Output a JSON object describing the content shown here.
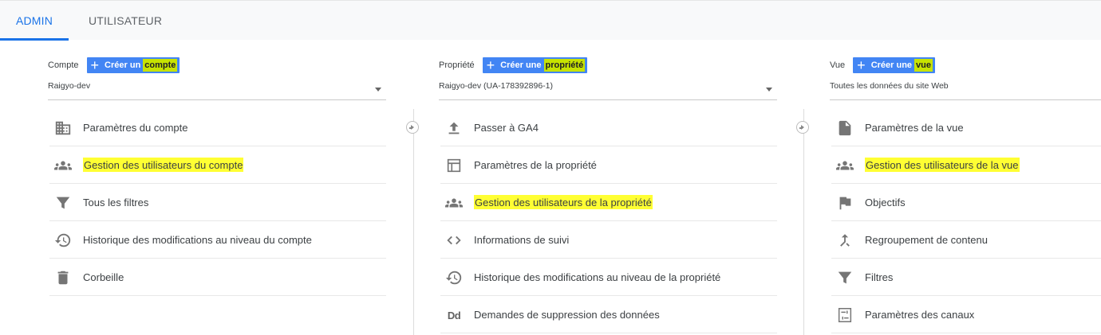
{
  "tabs": {
    "admin": "ADMIN",
    "user": "UTILISATEUR"
  },
  "account": {
    "label": "Compte",
    "create_prefix": "Créer un",
    "create_highlight": "compte",
    "selected": "Raigyo-dev",
    "items": [
      {
        "label": "Paramètres du compte",
        "icon": "building-icon"
      },
      {
        "label": "Gestion des utilisateurs du compte",
        "icon": "people-icon"
      },
      {
        "label": "Tous les filtres",
        "icon": "filter-icon"
      },
      {
        "label": "Historique des modifications au niveau du compte",
        "icon": "history-icon"
      },
      {
        "label": "Corbeille",
        "icon": "trash-icon"
      }
    ]
  },
  "property": {
    "label": "Propriété",
    "create_prefix": "Créer une",
    "create_highlight": "propriété",
    "selected": "Raigyo-dev (UA-178392896-1)",
    "items": [
      {
        "label": "Passer à GA4",
        "icon": "upload-icon"
      },
      {
        "label": "Paramètres de la propriété",
        "icon": "layout-icon"
      },
      {
        "label": "Gestion des utilisateurs de la propriété",
        "icon": "people-icon"
      },
      {
        "label": "Informations de suivi",
        "icon": "code-icon"
      },
      {
        "label": "Historique des modifications au niveau de la propriété",
        "icon": "history-icon"
      },
      {
        "label": "Demandes de suppression des données",
        "icon": "dd-icon"
      }
    ]
  },
  "view": {
    "label": "Vue",
    "create_prefix": "Créer une",
    "create_highlight": "vue",
    "selected": "Toutes les données du site Web",
    "items": [
      {
        "label": "Paramètres de la vue",
        "icon": "document-icon"
      },
      {
        "label": "Gestion des utilisateurs de la vue",
        "icon": "people-icon"
      },
      {
        "label": "Objectifs",
        "icon": "flag-icon"
      },
      {
        "label": "Regroupement de contenu",
        "icon": "merge-icon"
      },
      {
        "label": "Filtres",
        "icon": "filter-icon"
      },
      {
        "label": "Paramètres des canaux",
        "icon": "channel-settings-icon"
      }
    ]
  },
  "dd_glyph": "Dd",
  "colors": {
    "accent": "#1a73e8",
    "button": "#4285f4",
    "highlight": "#ffff33"
  }
}
